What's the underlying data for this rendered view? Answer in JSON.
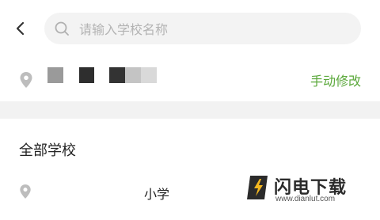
{
  "search": {
    "placeholder": "请输入学校名称",
    "value": ""
  },
  "location": {
    "manual_edit_label": "手动修改"
  },
  "section": {
    "title": "全部学校"
  },
  "schools": [
    {
      "name": "小学"
    }
  ],
  "watermark": {
    "brand": "闪电下载",
    "url": "www.dianlut.com"
  },
  "colors": {
    "accent": "#5aa83a",
    "band": "#f2f2f2",
    "search_bg": "#f3f3f3"
  }
}
